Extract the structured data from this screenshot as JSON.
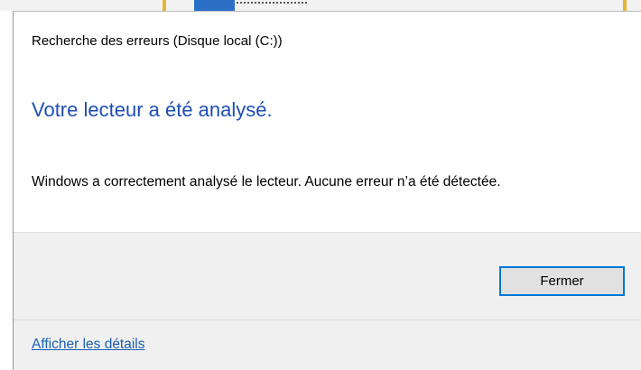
{
  "dialog": {
    "title": "Recherche des erreurs (Disque local (C:))",
    "heading": "Votre lecteur a été analysé.",
    "message": "Windows a correctement analysé le lecteur. Aucune erreur n’a été détectée.",
    "close_label": "Fermer",
    "details_link": "Afficher les détails"
  },
  "colors": {
    "heading": "#1c4fb3",
    "link": "#1a5fb4",
    "button_focus_border": "#0078d7",
    "footer_bg": "#f0f0f0"
  }
}
